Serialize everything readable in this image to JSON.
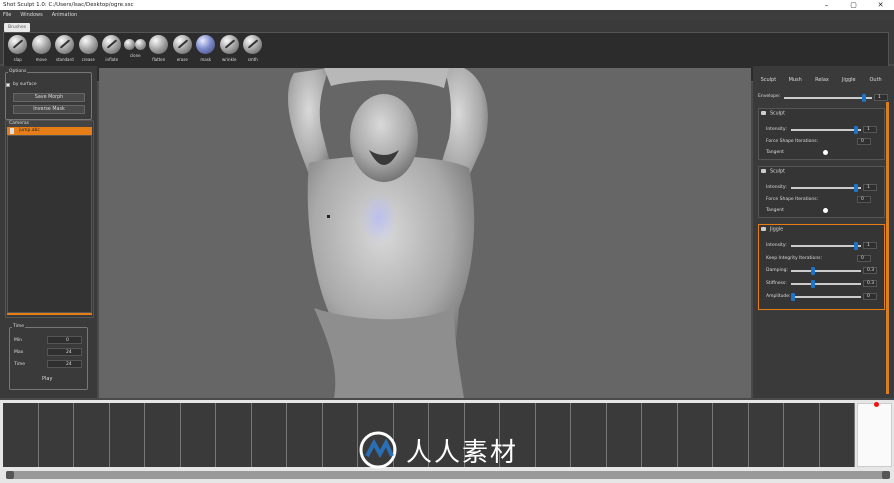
{
  "window": {
    "title": "Shot Sculpt 1.0: C:/Users/Isac/Desktop/ogre.ssc"
  },
  "menu": [
    "File",
    "Windows",
    "Animation"
  ],
  "shelf": {
    "tab": "Brushes",
    "tools": [
      "slap",
      "move",
      "standard",
      "crease",
      "inflate",
      "clone",
      "flatten",
      "erase",
      "mask",
      "wrinkle",
      "smth"
    ]
  },
  "left": {
    "options_title": "Options",
    "by_surface": "by surface",
    "save_morph": "Save Morph",
    "inverse_mask": "Inverse Mask",
    "cameras_title": "Cameras",
    "camera_item": "jump.abc",
    "time_title": "Time",
    "time_rows": [
      {
        "label": "Min",
        "value": "0"
      },
      {
        "label": "Max",
        "value": "24"
      },
      {
        "label": "Time",
        "value": "24"
      }
    ],
    "play": "Play"
  },
  "right": {
    "tabs": [
      "Sculpt",
      "Mush",
      "Relax",
      "Jiggle",
      "Outh"
    ],
    "envelope_label": "Envelope:",
    "envelope_value": "1",
    "envelope_level": 0.93,
    "sections": [
      {
        "title": "Sculpt",
        "intensity_label": "Intensity:",
        "intensity_value": "1",
        "intensity_level": 0.95,
        "iter_label": "Force Shape Iterations:",
        "iter_value": "0",
        "tangent_label": "Tangent"
      },
      {
        "title": "Sculpt",
        "intensity_label": "Intensity:",
        "intensity_value": "1",
        "intensity_level": 0.95,
        "iter_label": "Force Shape Iterations:",
        "iter_value": "0",
        "tangent_label": "Tangent"
      }
    ],
    "jiggle": {
      "title": "Jiggle",
      "intensity_label": "Intensity:",
      "intensity_value": "1",
      "intensity_level": 0.95,
      "keep_label": "Keep Integrity Iterations:",
      "keep_value": "0",
      "damping_label": "Damping:",
      "damping_value": "0.3",
      "damping_level": 0.3,
      "stiffness_label": "Stiffness:",
      "stiffness_value": "0.3",
      "stiffness_level": 0.3,
      "amplitude_label": "Amplitude:",
      "amplitude_value": "0",
      "amplitude_level": 0.0
    }
  },
  "watermark": "人人素材",
  "colors": {
    "accent": "#e67e18",
    "slider_knob": "#1e74c8"
  }
}
